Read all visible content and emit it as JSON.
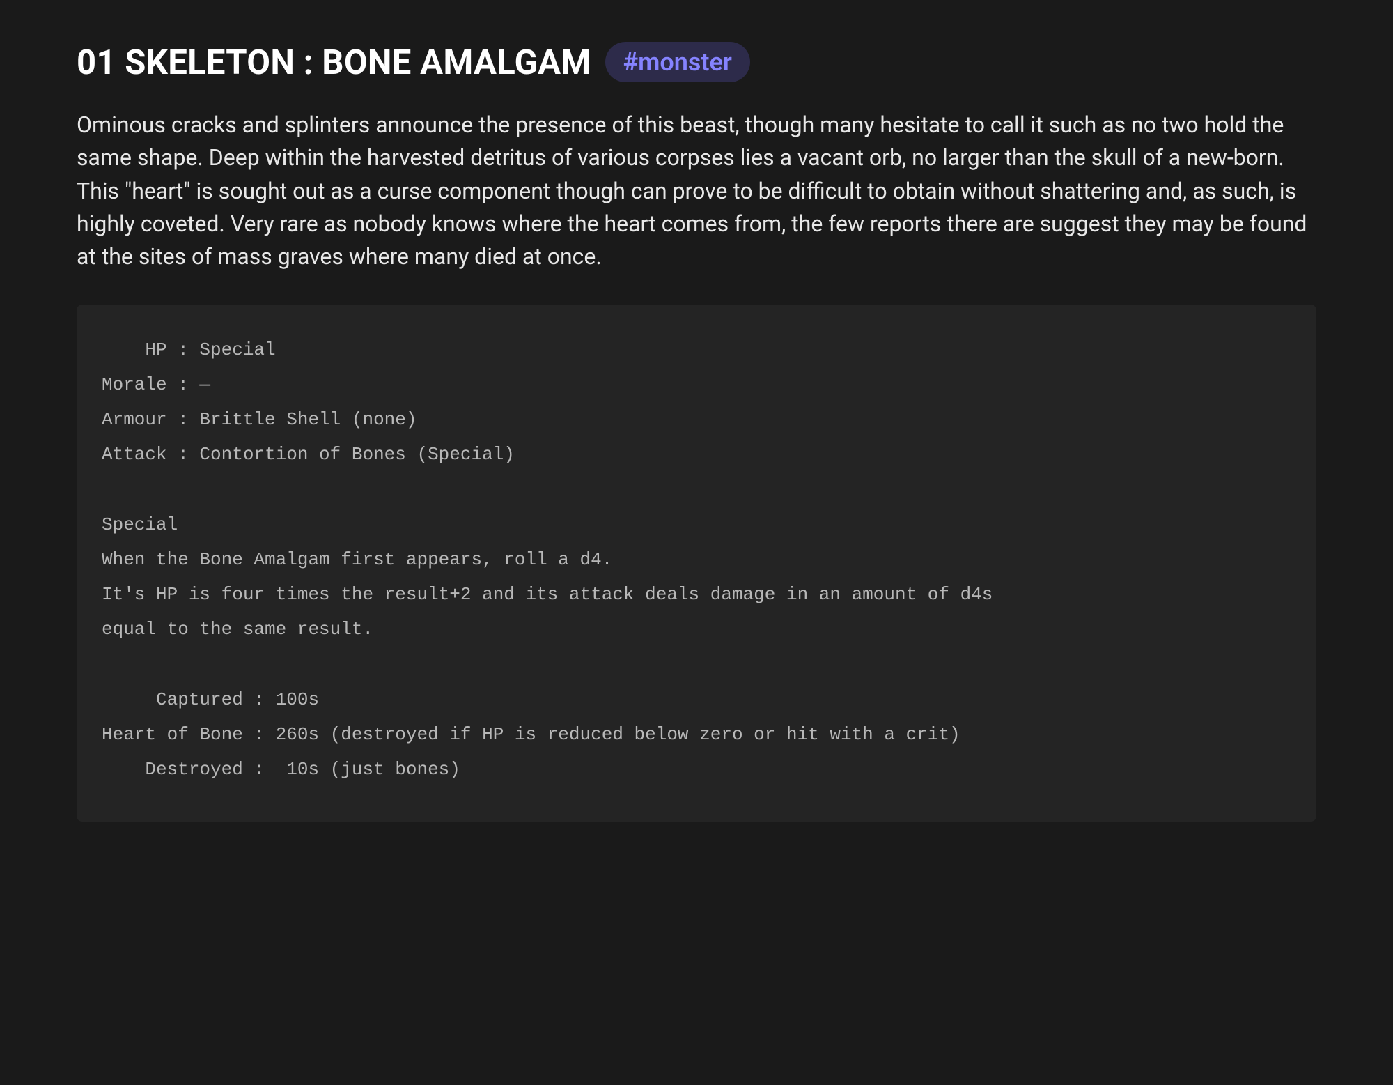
{
  "title": "01 SKELETON : BONE AMALGAM",
  "tag": "#monster",
  "description": "Ominous cracks and splinters announce the presence of this beast, though many hesitate to call it such as no two hold the same shape. Deep within the harvested detritus of various corpses lies a vacant orb, no larger than the skull of a new-born. This \"heart\" is sought out as a curse component though can prove to be difficult to obtain without shattering and, as such, is highly coveted. Very rare as nobody knows where the heart comes from, the few reports there are suggest they may be found at the sites of mass graves where many died at once.",
  "statblock": "    HP : Special\nMorale : —\nArmour : Brittle Shell (none)\nAttack : Contortion of Bones (Special)\n\nSpecial\nWhen the Bone Amalgam first appears, roll a d4.\nIt's HP is four times the result+2 and its attack deals damage in an amount of d4s\nequal to the same result.\n\n     Captured : 100s\nHeart of Bone : 260s (destroyed if HP is reduced below zero or hit with a crit)\n    Destroyed :  10s (just bones)"
}
